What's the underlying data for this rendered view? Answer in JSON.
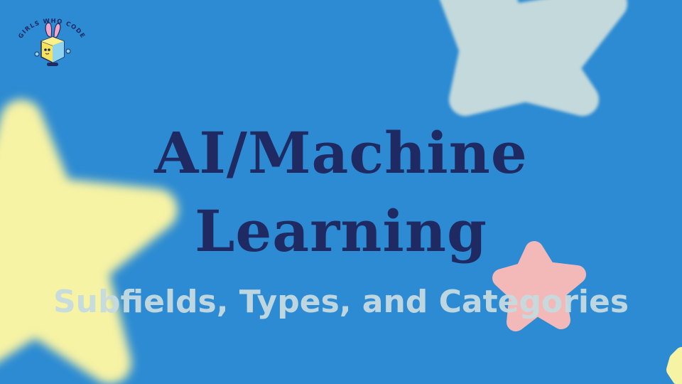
{
  "slide": {
    "title_line_1": "AI/Machine",
    "title_line_2": "Learning",
    "subtitle": "Subfields, Types, and Categories"
  },
  "logo": {
    "text": "GIRLS WHO CODE"
  },
  "colors": {
    "background": "#2c8bd2",
    "title": "#1f2a63",
    "subtitle": "#c6dbe0",
    "star_yellow": "#f6f3a4",
    "star_grey": "#c3d9dc",
    "star_pink": "#f3b9b8",
    "logo_navy": "#1f2a63"
  },
  "icons": {
    "logo": "girls-who-code-logo-icon",
    "star_large": "yellow-star-icon",
    "star_top": "grey-star-icon",
    "star_small": "pink-star-icon"
  }
}
